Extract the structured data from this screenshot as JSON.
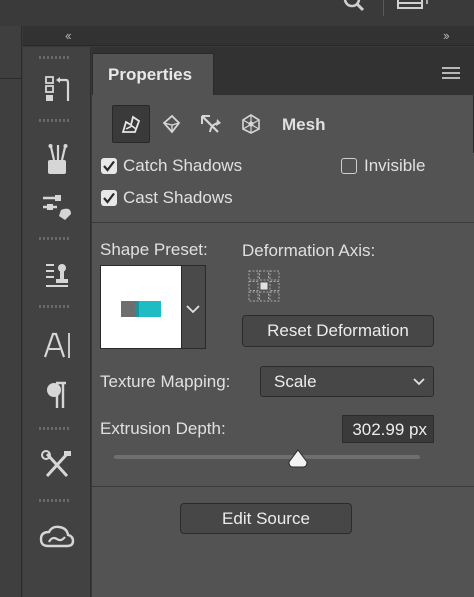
{
  "panel": {
    "tab_title": "Properties",
    "icons": [
      "3d-scene-icon",
      "3d-material-icon",
      "3d-deform-icon",
      "3d-coordinates-icon"
    ],
    "mesh_label": "Mesh"
  },
  "options": {
    "catch_shadows": {
      "label": "Catch Shadows",
      "checked": true
    },
    "invisible": {
      "label": "Invisible",
      "checked": false
    },
    "cast_shadows": {
      "label": "Cast Shadows",
      "checked": true
    }
  },
  "shape": {
    "preset_label": "Shape Preset:",
    "axis_label": "Deformation Axis:",
    "reset_button": "Reset Deformation"
  },
  "texture": {
    "label": "Texture Mapping:",
    "value": "Scale"
  },
  "extrusion": {
    "label": "Extrusion Depth:",
    "value": "302.99 px",
    "slider_fraction": 0.6
  },
  "edit_source": "Edit Source",
  "colors": {
    "accent_cyan": "#1fbcc4",
    "preset_gray": "#6e6e6e"
  }
}
